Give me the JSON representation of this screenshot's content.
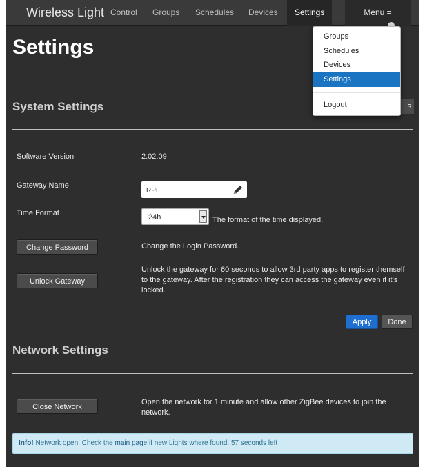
{
  "navbar": {
    "brand": "Wireless Light",
    "links": [
      "Control",
      "Groups",
      "Schedules",
      "Devices",
      "Settings"
    ],
    "menu_label": "Menu ="
  },
  "dropdown": {
    "items": [
      "Groups",
      "Schedules",
      "Devices",
      "Settings"
    ],
    "active": "Settings",
    "logout": "Logout"
  },
  "page": {
    "title": "Settings"
  },
  "system_settings": {
    "title": "System Settings",
    "obscured_button_label": "s",
    "software_version_label": "Software Version",
    "software_version": "2.02.09",
    "gateway_name_label": "Gateway Name",
    "gateway_name": "RPI",
    "time_format_label": "Time Format",
    "time_format": "24h",
    "time_format_hint": "The format of the time displayed.",
    "change_password_button": "Change Password",
    "change_password_desc": "Change the Login Password.",
    "unlock_button": "Unlock Gateway",
    "unlock_desc": "Unlock the gateway for 60 seconds to allow 3rd party apps to register themself to the gateway. After the registration they can access the gateway even if it's locked.",
    "apply_button": "Apply",
    "done_button": "Done"
  },
  "network_settings": {
    "title": "Network Settings",
    "close_button": "Close Network",
    "close_desc": "Open the network for 1 minute and allow other ZigBee devices to join the network."
  },
  "alert": {
    "strong": "Info!",
    "text_before": "Network open. Check the",
    "link": "main page",
    "text_after": "if new Lights where found. 57 seconds left"
  },
  "colors": {
    "background": "#2e2e2e",
    "primary": "#1f6fd1",
    "alert_bg": "#cfeaf4"
  }
}
